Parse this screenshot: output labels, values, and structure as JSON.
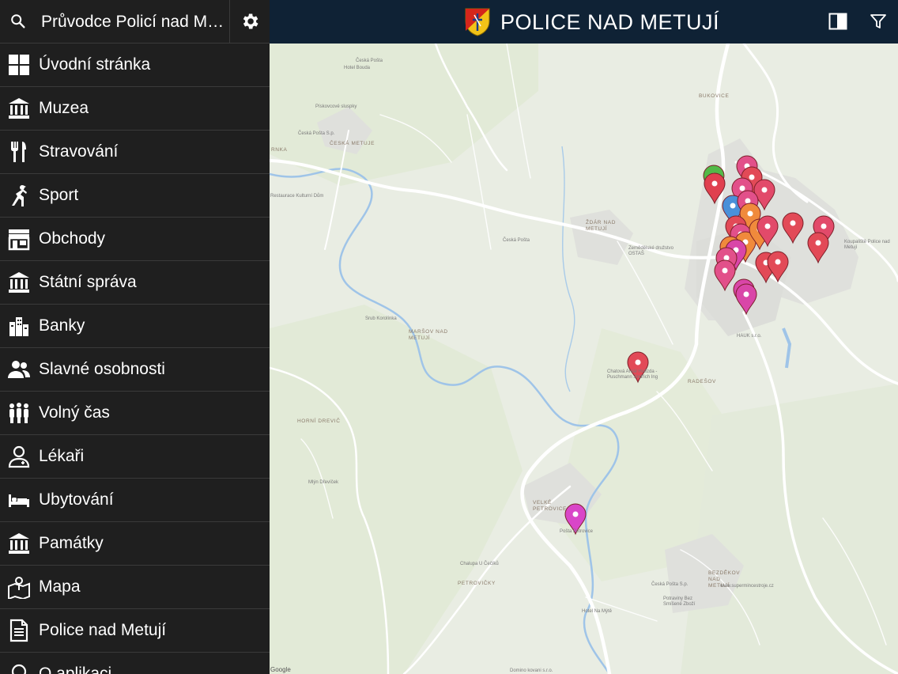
{
  "sidebar": {
    "title": "Průvodce Policí nad Me...",
    "items": [
      {
        "label": "Úvodní stránka",
        "icon": "grid-icon"
      },
      {
        "label": "Muzea",
        "icon": "museum-icon"
      },
      {
        "label": "Stravování",
        "icon": "fork-knife-icon"
      },
      {
        "label": "Sport",
        "icon": "sport-icon"
      },
      {
        "label": "Obchody",
        "icon": "shop-icon"
      },
      {
        "label": "Státní správa",
        "icon": "government-icon"
      },
      {
        "label": "Banky",
        "icon": "bank-icon"
      },
      {
        "label": "Slavné osobnosti",
        "icon": "people-icon"
      },
      {
        "label": "Volný čas",
        "icon": "group-icon"
      },
      {
        "label": "Lékaři",
        "icon": "doctor-icon"
      },
      {
        "label": "Ubytování",
        "icon": "bed-icon"
      },
      {
        "label": "Památky",
        "icon": "monument-icon"
      },
      {
        "label": "Mapa",
        "icon": "map-icon"
      },
      {
        "label": "Police nad Metují",
        "icon": "document-icon"
      },
      {
        "label": "O aplikaci",
        "icon": "bulb-icon"
      }
    ]
  },
  "topbar": {
    "title": "POLICE NAD METUJÍ",
    "accent": "#0f2235"
  },
  "map": {
    "labels": [
      {
        "text": "Česká Pošta"
      },
      {
        "text": "Hotel Bouda"
      },
      {
        "text": "Pískovcové sluspky"
      },
      {
        "text": "Česká Pošta S.p."
      },
      {
        "text": "ČESKÁ METUJE"
      },
      {
        "text": "RNKA"
      },
      {
        "text": "Restaurace Kulturní Dům"
      },
      {
        "text": "BUKOVICE"
      },
      {
        "text": "ŽDÁR NAD METUJÍ"
      },
      {
        "text": "Zemědělské družstvo OSTAŠ"
      },
      {
        "text": "Česká Pošta"
      },
      {
        "text": "Koupaliště Police nad Metují"
      },
      {
        "text": "Srub Korolínka"
      },
      {
        "text": "MARŠOV NAD METUJÍ"
      },
      {
        "text": "HAUK s.r.o."
      },
      {
        "text": "Chatová Areál Hvězda - Puschmann Jindřich Ing"
      },
      {
        "text": "RADEŠOV"
      },
      {
        "text": "HORNÍ DREVIČ"
      },
      {
        "text": "Mlýn Dřevíček"
      },
      {
        "text": "VELKÉ PETROVICE"
      },
      {
        "text": "Pošta Petrovice"
      },
      {
        "text": "Chalupa U Čečíků"
      },
      {
        "text": "PETROVIČKY"
      },
      {
        "text": "Hotel Na Mýtě"
      },
      {
        "text": "BEZDĚKOV NAD METUJÍ"
      },
      {
        "text": "Česká Pošta S.p."
      },
      {
        "text": "Potraviny Bez Smíšené Zboží"
      },
      {
        "text": "www.supermincestroje.cz"
      },
      {
        "text": "Domino kovani s.r.o."
      },
      {
        "text": "Google"
      }
    ],
    "colors": {
      "water": "#9fc4e8",
      "road": "#ffffff",
      "urban": "#dfe1de",
      "forest": "#dfe8d4"
    }
  }
}
